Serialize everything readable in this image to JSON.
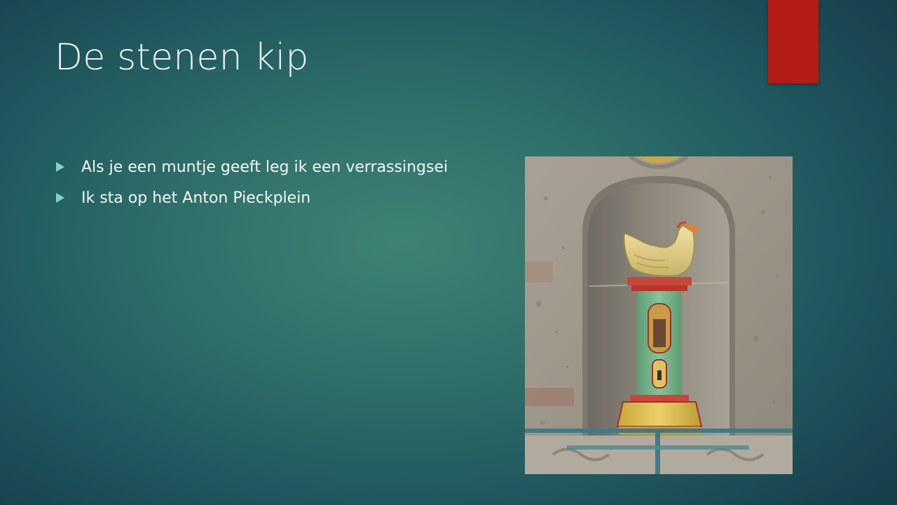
{
  "slide": {
    "title": "De stenen kip",
    "bullets": [
      "Als je een muntje geeft leg ik een verrassingsei",
      "Ik sta op het Anton Pieckplein"
    ]
  },
  "colors": {
    "accent": "#b31b17",
    "bullet": "#7fd4c8",
    "text": "#f2f6f5"
  },
  "icons": {
    "bullet": "triangle-bullet-icon"
  }
}
